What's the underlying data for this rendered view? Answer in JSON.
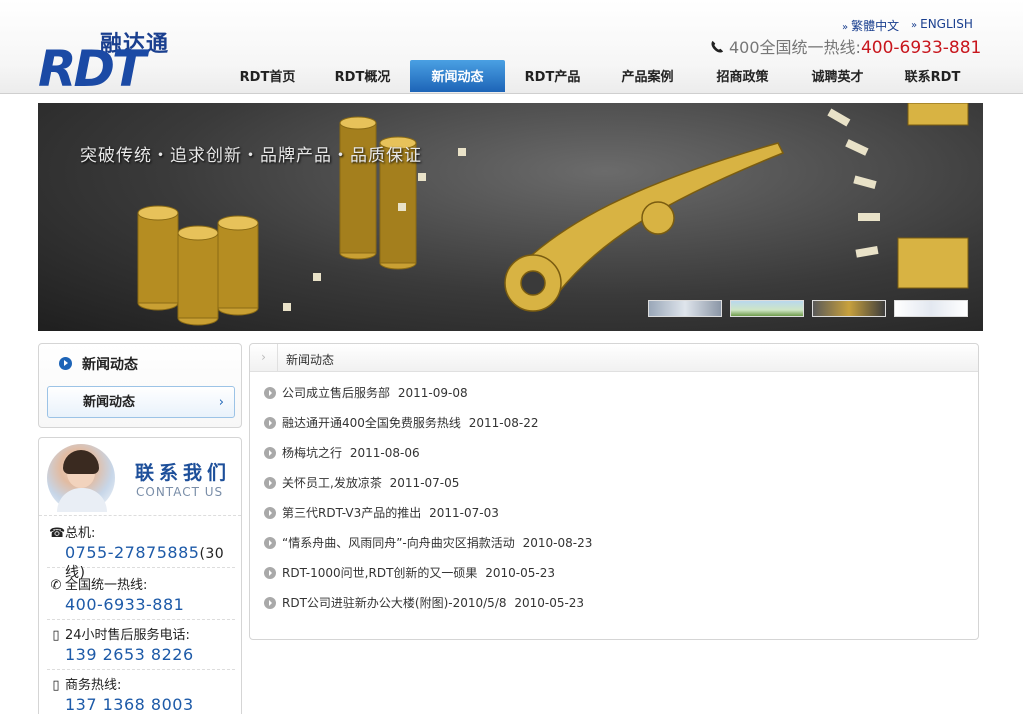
{
  "header": {
    "logo_cn": "融达通",
    "logo_en": "RDT",
    "lang_traditional": "繁體中文",
    "lang_english": "ENGLISH",
    "hotline_label": "400全国统一热线:",
    "hotline_number": "400-6933-881"
  },
  "nav": [
    {
      "label": "RDT首页",
      "active": false
    },
    {
      "label": "RDT概况",
      "active": false
    },
    {
      "label": "新闻动态",
      "active": true
    },
    {
      "label": "RDT产品",
      "active": false
    },
    {
      "label": "产品案例",
      "active": false
    },
    {
      "label": "招商政策",
      "active": false
    },
    {
      "label": "诚聘英才",
      "active": false
    },
    {
      "label": "联系RDT",
      "active": false
    }
  ],
  "banner": {
    "slogan": "突破传统・追求创新・品牌产品・品质保证"
  },
  "sidebar": {
    "title": "新闻动态",
    "link": "新闻动态"
  },
  "contact": {
    "title_cn": "联系我们",
    "title_en": "CONTACT US",
    "switchboard_label": "总机:",
    "switchboard_number": "0755-27875885",
    "switchboard_suffix": "(30线)",
    "hotline_label": "全国统一热线:",
    "hotline_number": "400-6933-881",
    "aftersales_label": "24小时售后服务电话:",
    "aftersales_number": "139 2653 8226",
    "business_label": "商务热线:",
    "business_number": "137 1368 8003"
  },
  "news": {
    "heading": "新闻动态",
    "items": [
      {
        "title": "公司成立售后服务部",
        "date": "2011-09-08"
      },
      {
        "title": "融达通开通400全国免费服务热线",
        "date": "2011-08-22"
      },
      {
        "title": "杨梅坑之行",
        "date": "2011-08-06"
      },
      {
        "title": "关怀员工,发放凉茶",
        "date": "2011-07-05"
      },
      {
        "title": "第三代RDT-V3产品的推出",
        "date": "2011-07-03"
      },
      {
        "title": "“情系舟曲、风雨同舟”-向舟曲灾区捐款活动",
        "date": "2010-08-23"
      },
      {
        "title": "RDT-1000问世,RDT创新的又一硕果",
        "date": "2010-05-23"
      },
      {
        "title": "RDT公司进驻新办公大楼(附图)-2010/5/8",
        "date": "2010-05-23"
      }
    ]
  }
}
